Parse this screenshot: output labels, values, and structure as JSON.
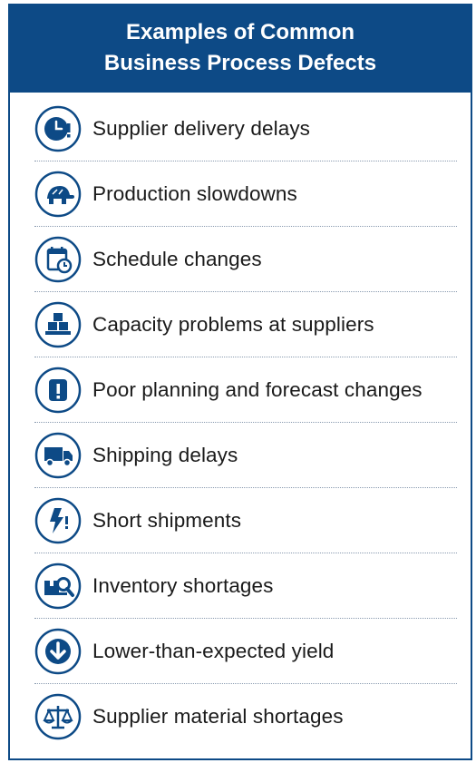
{
  "header": {
    "title_line1": "Examples of Common",
    "title_line2": "Business Process Defects"
  },
  "colors": {
    "brand_blue": "#0d4a86",
    "text": "#1a1a1a",
    "divider": "#8a9bb0"
  },
  "items": [
    {
      "label": "Supplier delivery delays",
      "icon": "clock-alert-icon"
    },
    {
      "label": "Production slowdowns",
      "icon": "turtle-icon"
    },
    {
      "label": "Schedule changes",
      "icon": "calendar-clock-icon"
    },
    {
      "label": "Capacity problems at suppliers",
      "icon": "stacked-boxes-icon"
    },
    {
      "label": "Poor planning and forecast changes",
      "icon": "alert-badge-icon"
    },
    {
      "label": "Shipping delays",
      "icon": "truck-icon"
    },
    {
      "label": "Short shipments",
      "icon": "lightning-alert-icon"
    },
    {
      "label": "Inventory shortages",
      "icon": "box-search-icon"
    },
    {
      "label": "Lower-than-expected yield",
      "icon": "down-arrow-icon"
    },
    {
      "label": "Supplier material shortages",
      "icon": "balance-scale-icon"
    }
  ]
}
